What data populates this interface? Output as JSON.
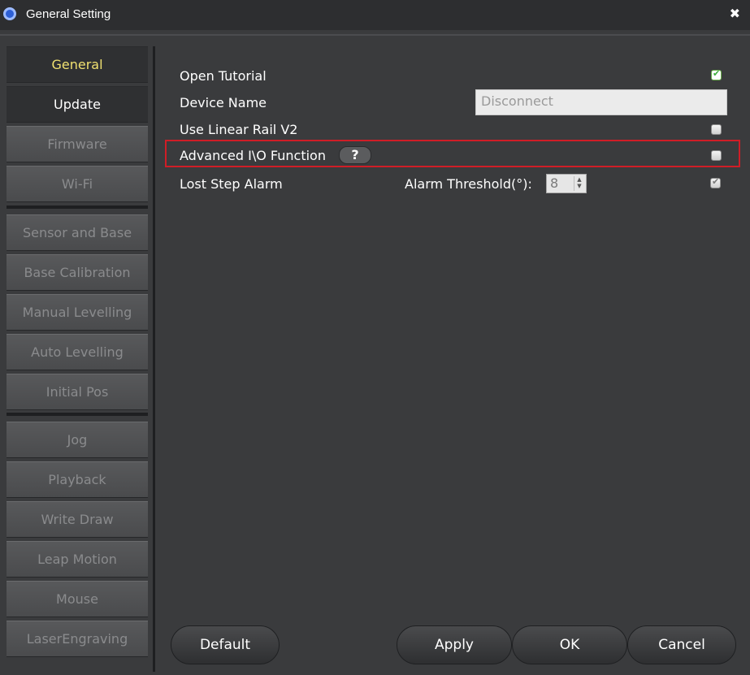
{
  "window": {
    "title": "General Setting",
    "close_glyph": "✖"
  },
  "sidebar": {
    "items": [
      {
        "label": "General",
        "state": "active"
      },
      {
        "label": "Update",
        "state": "normal"
      },
      {
        "label": "Firmware",
        "state": "disabled"
      },
      {
        "label": "Wi-Fi",
        "state": "disabled"
      },
      {
        "label": "Sensor and Base",
        "state": "disabled"
      },
      {
        "label": "Base Calibration",
        "state": "disabled"
      },
      {
        "label": "Manual Levelling",
        "state": "disabled"
      },
      {
        "label": "Auto Levelling",
        "state": "disabled"
      },
      {
        "label": "Initial Pos",
        "state": "disabled"
      },
      {
        "label": "Jog",
        "state": "disabled"
      },
      {
        "label": "Playback",
        "state": "disabled"
      },
      {
        "label": "Write  Draw",
        "state": "disabled"
      },
      {
        "label": "Leap Motion",
        "state": "disabled"
      },
      {
        "label": "Mouse",
        "state": "disabled"
      },
      {
        "label": "LaserEngraving",
        "state": "disabled"
      }
    ]
  },
  "settings": {
    "open_tutorial": {
      "label": "Open Tutorial",
      "checked": true
    },
    "device_name": {
      "label": "Device Name",
      "value": "Disconnect"
    },
    "linear_rail": {
      "label": "Use Linear Rail V2",
      "checked": false
    },
    "advanced_io": {
      "label": "Advanced I\\O Function",
      "help": "?",
      "checked": false
    },
    "lost_step": {
      "label": "Lost Step Alarm",
      "threshold_label": "Alarm Threshold(°):",
      "threshold_value": "8",
      "checked": true
    }
  },
  "buttons": {
    "default": "Default",
    "apply": "Apply",
    "ok": "OK",
    "cancel": "Cancel"
  },
  "colors": {
    "background": "#3a3b3d",
    "active_tab_text": "#f0e070",
    "highlight_border": "#d01d26",
    "check_green": "#3cae3c"
  }
}
